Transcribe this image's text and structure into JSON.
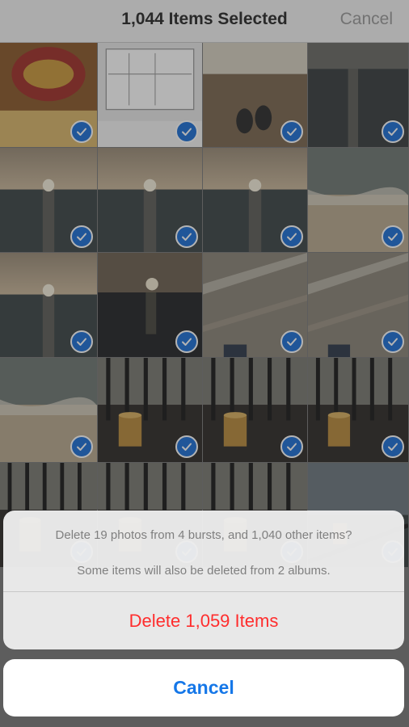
{
  "navbar": {
    "title": "1,044 Items Selected",
    "cancel_label": "Cancel"
  },
  "grid": {
    "tiles": [
      {
        "kind": "chips",
        "selected": true
      },
      {
        "kind": "document",
        "selected": true
      },
      {
        "kind": "feet",
        "selected": true
      },
      {
        "kind": "sea-dark",
        "selected": true
      },
      {
        "kind": "sunset",
        "selected": true
      },
      {
        "kind": "sunset",
        "selected": true
      },
      {
        "kind": "sunset",
        "selected": true
      },
      {
        "kind": "beach",
        "selected": true
      },
      {
        "kind": "sunset",
        "selected": true
      },
      {
        "kind": "sunset-dark",
        "selected": true
      },
      {
        "kind": "patio",
        "selected": true
      },
      {
        "kind": "patio",
        "selected": true
      },
      {
        "kind": "beach",
        "selected": true
      },
      {
        "kind": "railing-drink",
        "selected": true
      },
      {
        "kind": "railing-drink",
        "selected": true
      },
      {
        "kind": "railing-drink",
        "selected": true
      },
      {
        "kind": "railing-drink",
        "selected": true
      },
      {
        "kind": "railing-drink",
        "selected": true
      },
      {
        "kind": "railing-drink",
        "selected": true
      },
      {
        "kind": "balcony-drink",
        "selected": true
      }
    ]
  },
  "action_sheet": {
    "message_line1": "Delete 19 photos from 4 bursts, and 1,040 other items?",
    "message_line2": "Some items will also be deleted from 2 albums.",
    "delete_label": "Delete 1,059 Items",
    "cancel_label": "Cancel"
  },
  "colors": {
    "accent": "#1577e8",
    "destructive": "#ff2d2d",
    "check_badge": "#1d6fd6"
  }
}
